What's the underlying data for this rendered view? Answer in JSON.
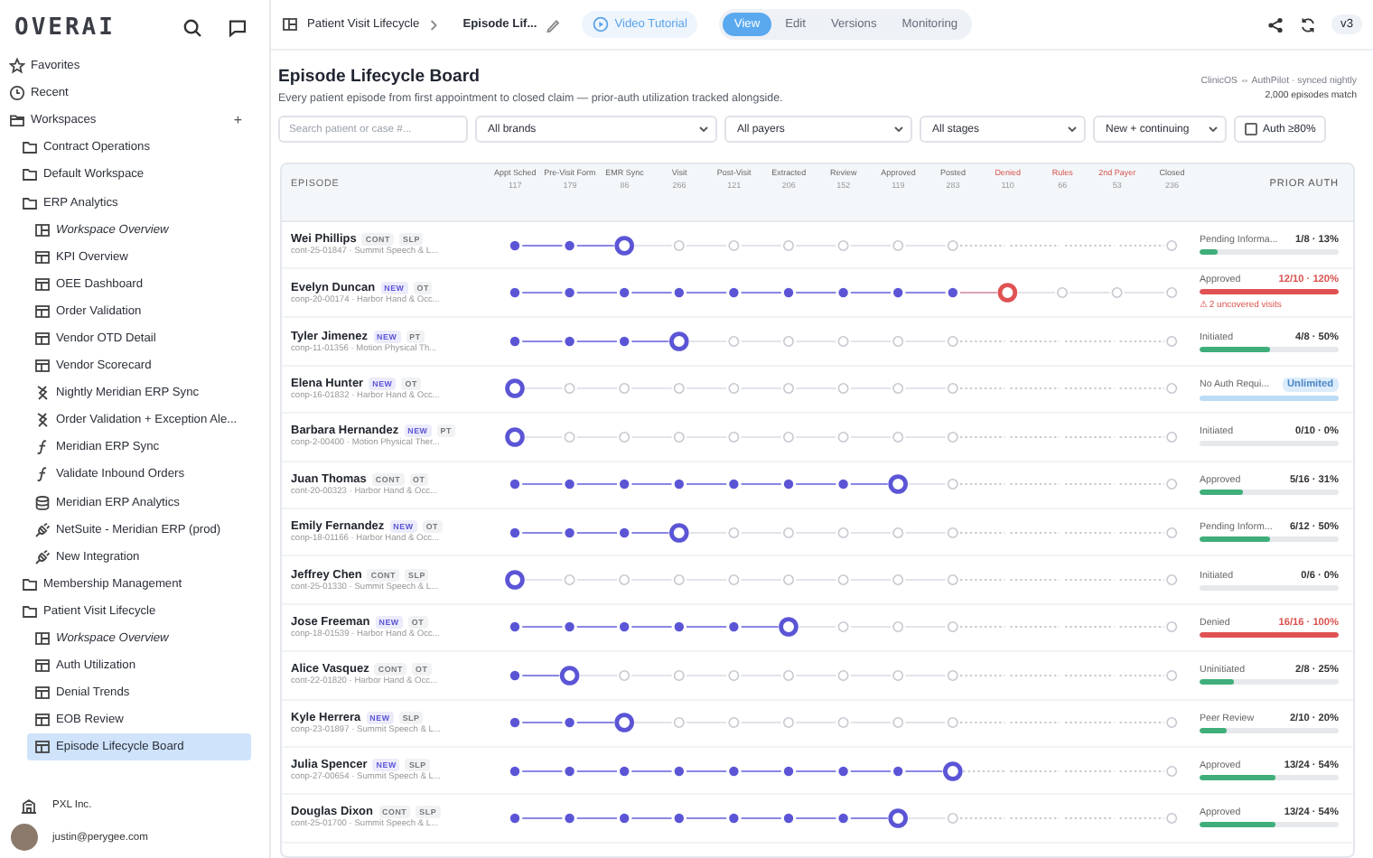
{
  "sidebar": {
    "logo": "OVERAI",
    "sections": [
      {
        "label": "Favorites",
        "kind": "favorites"
      },
      {
        "label": "Recent",
        "kind": "recent"
      },
      {
        "label": "Workspaces",
        "kind": "workspaces",
        "add": "+",
        "children": [
          {
            "label": "Contract Operations",
            "kind": "folder"
          },
          {
            "label": "Default Workspace",
            "kind": "folder"
          },
          {
            "label": "ERP Analytics",
            "kind": "folder",
            "children": [
              {
                "label": "Workspace Overview",
                "kind": "overview",
                "selected": false
              },
              {
                "label": "KPI Overview",
                "kind": "dashboard",
                "selected": false
              },
              {
                "label": "OEE Dashboard",
                "kind": "dashboard",
                "selected": false
              },
              {
                "label": "Order Validation",
                "kind": "dashboard",
                "selected": false
              },
              {
                "label": "Vendor OTD Detail",
                "kind": "dashboard",
                "selected": false
              },
              {
                "label": "Vendor Scorecard",
                "kind": "dashboard",
                "selected": false
              },
              {
                "label": "Nightly Meridian ERP Sync",
                "kind": "flow",
                "selected": false
              },
              {
                "label": "Order Validation + Exception Ale...",
                "kind": "flow",
                "selected": false
              },
              {
                "label": "Meridian ERP Sync",
                "kind": "function",
                "selected": false
              },
              {
                "label": "Validate Inbound Orders",
                "kind": "function",
                "selected": false
              },
              {
                "label": "Meridian ERP Analytics",
                "kind": "database",
                "selected": false
              },
              {
                "label": "NetSuite - Meridian ERP (prod)",
                "kind": "integration",
                "selected": false
              },
              {
                "label": "New Integration",
                "kind": "integration",
                "selected": false
              }
            ]
          },
          {
            "label": "Membership Management",
            "kind": "folder"
          },
          {
            "label": "Patient Visit Lifecycle",
            "kind": "folder",
            "children": [
              {
                "label": "Workspace Overview",
                "kind": "overview",
                "selected": false
              },
              {
                "label": "Auth Utilization",
                "kind": "dashboard",
                "selected": false
              },
              {
                "label": "Denial Trends",
                "kind": "dashboard",
                "selected": false
              },
              {
                "label": "EOB Review",
                "kind": "dashboard",
                "selected": false
              },
              {
                "label": "Episode Lifecycle Board",
                "kind": "dashboard",
                "selected": true
              }
            ]
          }
        ]
      }
    ],
    "org": "PXL Inc.",
    "user": "justin@perygee.com"
  },
  "topbar": {
    "breadcrumb": [
      "Patient Visit Lifecycle",
      "Episode Lif..."
    ],
    "tutorial": "Video Tutorial",
    "tabs": [
      {
        "label": "View",
        "selected": true
      },
      {
        "label": "Edit",
        "selected": false
      },
      {
        "label": "Versions",
        "selected": false
      },
      {
        "label": "Monitoring",
        "selected": false
      }
    ],
    "version": "v3"
  },
  "page": {
    "title": "Episode Lifecycle Board",
    "subtitle": "Every patient episode from first appointment to closed claim — prior-auth utilization tracked alongside.",
    "sync": "ClinicOS ⇔ AuthPilot · synced nightly",
    "match_count": "2,000 episodes match"
  },
  "filters": {
    "search": {
      "placeholder": "Search patient or case #..."
    },
    "selects": [
      "All brands",
      "All payers",
      "All stages",
      "New + continuing"
    ],
    "checkbox": {
      "label": "Auth ≥80%",
      "checked": false
    }
  },
  "table": {
    "episode_header": "EPISODE",
    "auth_header": "PRIOR AUTH",
    "stages": [
      {
        "label": "Appt Sched",
        "count": "117",
        "exception": false
      },
      {
        "label": "Pre-Visit Form",
        "count": "179",
        "exception": false
      },
      {
        "label": "EMR Sync",
        "count": "86",
        "exception": false
      },
      {
        "label": "Visit",
        "count": "266",
        "exception": false
      },
      {
        "label": "Post-Visit",
        "count": "121",
        "exception": false
      },
      {
        "label": "Extracted",
        "count": "206",
        "exception": false
      },
      {
        "label": "Review",
        "count": "152",
        "exception": false
      },
      {
        "label": "Approved",
        "count": "119",
        "exception": false
      },
      {
        "label": "Posted",
        "count": "283",
        "exception": false
      },
      {
        "label": "Denied",
        "count": "110",
        "exception": true
      },
      {
        "label": "Rules",
        "count": "66",
        "exception": true
      },
      {
        "label": "2nd Payer",
        "count": "53",
        "exception": true
      },
      {
        "label": "Closed",
        "count": "236",
        "exception": false
      }
    ],
    "rows": [
      {
        "name": "Wei Phillips",
        "tags": [
          {
            "label": "CONT",
            "kind": "cont"
          },
          {
            "label": "SLP",
            "kind": "discipline"
          }
        ],
        "case": "cont-25-01847 · Summit Speech & L...",
        "stages": [
          {
            "kind": "done"
          },
          {
            "kind": "done"
          },
          {
            "kind": "current"
          },
          {
            "kind": "pending"
          },
          {
            "kind": "pending"
          },
          {
            "kind": "pending"
          },
          {
            "kind": "pending"
          },
          {
            "kind": "pending"
          },
          {
            "kind": "pending"
          },
          {
            "kind": "skipped"
          },
          {
            "kind": "skipped"
          },
          {
            "kind": "skipped"
          },
          {
            "kind": "pending"
          }
        ],
        "auth": {
          "status": "Pending Informa...",
          "usage": "1/8 · 13%",
          "level": 0.13,
          "kind": "ok"
        }
      },
      {
        "name": "Evelyn Duncan",
        "tags": [
          {
            "label": "NEW",
            "kind": "new"
          },
          {
            "label": "OT",
            "kind": "discipline"
          }
        ],
        "case": "conp-20-00174 · Harbor Hand & Occ...",
        "stages": [
          {
            "kind": "done"
          },
          {
            "kind": "done"
          },
          {
            "kind": "done"
          },
          {
            "kind": "done"
          },
          {
            "kind": "done"
          },
          {
            "kind": "done"
          },
          {
            "kind": "done"
          },
          {
            "kind": "done"
          },
          {
            "kind": "done"
          },
          {
            "kind": "denied"
          },
          {
            "kind": "pending"
          },
          {
            "kind": "pending"
          },
          {
            "kind": "pending"
          }
        ],
        "auth": {
          "status": "Approved",
          "usage": "12/10 · 120%",
          "level": 1,
          "kind": "over",
          "warning": "⚠ 2 uncovered visits"
        }
      },
      {
        "name": "Tyler Jimenez",
        "tags": [
          {
            "label": "NEW",
            "kind": "new"
          },
          {
            "label": "PT",
            "kind": "discipline"
          }
        ],
        "case": "conp-11-01356 · Motion Physical Th...",
        "stages": [
          {
            "kind": "done"
          },
          {
            "kind": "done"
          },
          {
            "kind": "done"
          },
          {
            "kind": "current"
          },
          {
            "kind": "pending"
          },
          {
            "kind": "pending"
          },
          {
            "kind": "pending"
          },
          {
            "kind": "pending"
          },
          {
            "kind": "pending"
          },
          {
            "kind": "skipped"
          },
          {
            "kind": "skipped"
          },
          {
            "kind": "skipped"
          },
          {
            "kind": "pending"
          }
        ],
        "auth": {
          "status": "Initiated",
          "usage": "4/8 · 50%",
          "level": 0.5,
          "kind": "ok"
        }
      },
      {
        "name": "Elena Hunter",
        "tags": [
          {
            "label": "NEW",
            "kind": "new"
          },
          {
            "label": "OT",
            "kind": "discipline"
          }
        ],
        "case": "conp-16-01832 · Harbor Hand & Occ...",
        "stages": [
          {
            "kind": "current"
          },
          {
            "kind": "pending"
          },
          {
            "kind": "pending"
          },
          {
            "kind": "pending"
          },
          {
            "kind": "pending"
          },
          {
            "kind": "pending"
          },
          {
            "kind": "pending"
          },
          {
            "kind": "pending"
          },
          {
            "kind": "pending"
          },
          {
            "kind": "skipped"
          },
          {
            "kind": "skipped"
          },
          {
            "kind": "skipped"
          },
          {
            "kind": "pending"
          }
        ],
        "auth": {
          "status": "No Auth Requi...",
          "usage": "Unlimited",
          "level": 1,
          "kind": "unlimited"
        }
      },
      {
        "name": "Barbara Hernandez",
        "tags": [
          {
            "label": "NEW",
            "kind": "new"
          },
          {
            "label": "PT",
            "kind": "discipline"
          }
        ],
        "case": "conp-2-00400 · Motion Physical Ther...",
        "stages": [
          {
            "kind": "current"
          },
          {
            "kind": "pending"
          },
          {
            "kind": "pending"
          },
          {
            "kind": "pending"
          },
          {
            "kind": "pending"
          },
          {
            "kind": "pending"
          },
          {
            "kind": "pending"
          },
          {
            "kind": "pending"
          },
          {
            "kind": "pending"
          },
          {
            "kind": "skipped"
          },
          {
            "kind": "skipped"
          },
          {
            "kind": "skipped"
          },
          {
            "kind": "pending"
          }
        ],
        "auth": {
          "status": "Initiated",
          "usage": "0/10 · 0%",
          "level": 0,
          "kind": "ok"
        }
      },
      {
        "name": "Juan Thomas",
        "tags": [
          {
            "label": "CONT",
            "kind": "cont"
          },
          {
            "label": "OT",
            "kind": "discipline"
          }
        ],
        "case": "cont-20-00323 · Harbor Hand & Occ...",
        "stages": [
          {
            "kind": "done"
          },
          {
            "kind": "done"
          },
          {
            "kind": "done"
          },
          {
            "kind": "done"
          },
          {
            "kind": "done"
          },
          {
            "kind": "done"
          },
          {
            "kind": "done"
          },
          {
            "kind": "current"
          },
          {
            "kind": "pending"
          },
          {
            "kind": "skipped"
          },
          {
            "kind": "skipped"
          },
          {
            "kind": "skipped"
          },
          {
            "kind": "pending"
          }
        ],
        "auth": {
          "status": "Approved",
          "usage": "5/16 · 31%",
          "level": 0.31,
          "kind": "ok"
        }
      },
      {
        "name": "Emily Fernandez",
        "tags": [
          {
            "label": "NEW",
            "kind": "new"
          },
          {
            "label": "OT",
            "kind": "discipline"
          }
        ],
        "case": "conp-18-01166 · Harbor Hand & Occ...",
        "stages": [
          {
            "kind": "done"
          },
          {
            "kind": "done"
          },
          {
            "kind": "done"
          },
          {
            "kind": "current"
          },
          {
            "kind": "pending"
          },
          {
            "kind": "pending"
          },
          {
            "kind": "pending"
          },
          {
            "kind": "pending"
          },
          {
            "kind": "pending"
          },
          {
            "kind": "skipped"
          },
          {
            "kind": "skipped"
          },
          {
            "kind": "skipped"
          },
          {
            "kind": "pending"
          }
        ],
        "auth": {
          "status": "Pending Inform...",
          "usage": "6/12 · 50%",
          "level": 0.5,
          "kind": "ok"
        }
      },
      {
        "name": "Jeffrey Chen",
        "tags": [
          {
            "label": "CONT",
            "kind": "cont"
          },
          {
            "label": "SLP",
            "kind": "discipline"
          }
        ],
        "case": "cont-25-01330 · Summit Speech & L...",
        "stages": [
          {
            "kind": "current"
          },
          {
            "kind": "pending"
          },
          {
            "kind": "pending"
          },
          {
            "kind": "pending"
          },
          {
            "kind": "pending"
          },
          {
            "kind": "pending"
          },
          {
            "kind": "pending"
          },
          {
            "kind": "pending"
          },
          {
            "kind": "pending"
          },
          {
            "kind": "skipped"
          },
          {
            "kind": "skipped"
          },
          {
            "kind": "skipped"
          },
          {
            "kind": "pending"
          }
        ],
        "auth": {
          "status": "Initiated",
          "usage": "0/6 · 0%",
          "level": 0,
          "kind": "ok"
        }
      },
      {
        "name": "Jose Freeman",
        "tags": [
          {
            "label": "NEW",
            "kind": "new"
          },
          {
            "label": "OT",
            "kind": "discipline"
          }
        ],
        "case": "conp-18-01539 · Harbor Hand & Occ...",
        "stages": [
          {
            "kind": "done"
          },
          {
            "kind": "done"
          },
          {
            "kind": "done"
          },
          {
            "kind": "done"
          },
          {
            "kind": "done"
          },
          {
            "kind": "current"
          },
          {
            "kind": "pending"
          },
          {
            "kind": "pending"
          },
          {
            "kind": "pending"
          },
          {
            "kind": "skipped"
          },
          {
            "kind": "skipped"
          },
          {
            "kind": "skipped"
          },
          {
            "kind": "pending"
          }
        ],
        "auth": {
          "status": "Denied",
          "usage": "16/16 · 100%",
          "level": 1,
          "kind": "over"
        }
      },
      {
        "name": "Alice Vasquez",
        "tags": [
          {
            "label": "CONT",
            "kind": "cont"
          },
          {
            "label": "OT",
            "kind": "discipline"
          }
        ],
        "case": "cont-22-01820 · Harbor Hand & Occ...",
        "stages": [
          {
            "kind": "done"
          },
          {
            "kind": "current"
          },
          {
            "kind": "pending"
          },
          {
            "kind": "pending"
          },
          {
            "kind": "pending"
          },
          {
            "kind": "pending"
          },
          {
            "kind": "pending"
          },
          {
            "kind": "pending"
          },
          {
            "kind": "pending"
          },
          {
            "kind": "skipped"
          },
          {
            "kind": "skipped"
          },
          {
            "kind": "skipped"
          },
          {
            "kind": "pending"
          }
        ],
        "auth": {
          "status": "Uninitiated",
          "usage": "2/8 · 25%",
          "level": 0.25,
          "kind": "ok"
        }
      },
      {
        "name": "Kyle Herrera",
        "tags": [
          {
            "label": "NEW",
            "kind": "new"
          },
          {
            "label": "SLP",
            "kind": "discipline"
          }
        ],
        "case": "conp-23-01897 · Summit Speech & L...",
        "stages": [
          {
            "kind": "done"
          },
          {
            "kind": "done"
          },
          {
            "kind": "current"
          },
          {
            "kind": "pending"
          },
          {
            "kind": "pending"
          },
          {
            "kind": "pending"
          },
          {
            "kind": "pending"
          },
          {
            "kind": "pending"
          },
          {
            "kind": "pending"
          },
          {
            "kind": "skipped"
          },
          {
            "kind": "skipped"
          },
          {
            "kind": "skipped"
          },
          {
            "kind": "pending"
          }
        ],
        "auth": {
          "status": "Peer Review",
          "usage": "2/10 · 20%",
          "level": 0.2,
          "kind": "ok"
        }
      },
      {
        "name": "Julia Spencer",
        "tags": [
          {
            "label": "NEW",
            "kind": "new"
          },
          {
            "label": "SLP",
            "kind": "discipline"
          }
        ],
        "case": "conp-27-00654 · Summit Speech & L...",
        "stages": [
          {
            "kind": "done"
          },
          {
            "kind": "done"
          },
          {
            "kind": "done"
          },
          {
            "kind": "done"
          },
          {
            "kind": "done"
          },
          {
            "kind": "done"
          },
          {
            "kind": "done"
          },
          {
            "kind": "done"
          },
          {
            "kind": "current"
          },
          {
            "kind": "skipped"
          },
          {
            "kind": "skipped"
          },
          {
            "kind": "skipped"
          },
          {
            "kind": "pending"
          }
        ],
        "auth": {
          "status": "Approved",
          "usage": "13/24 · 54%",
          "level": 0.54,
          "kind": "ok"
        }
      },
      {
        "name": "Douglas Dixon",
        "tags": [
          {
            "label": "CONT",
            "kind": "cont"
          },
          {
            "label": "SLP",
            "kind": "discipline"
          }
        ],
        "case": "cont-25-01700 · Summit Speech & L...",
        "stages": [
          {
            "kind": "done"
          },
          {
            "kind": "done"
          },
          {
            "kind": "done"
          },
          {
            "kind": "done"
          },
          {
            "kind": "done"
          },
          {
            "kind": "done"
          },
          {
            "kind": "done"
          },
          {
            "kind": "current"
          },
          {
            "kind": "pending"
          },
          {
            "kind": "skipped"
          },
          {
            "kind": "skipped"
          },
          {
            "kind": "skipped"
          },
          {
            "kind": "pending"
          }
        ],
        "auth": {
          "status": "Approved",
          "usage": "13/24 · 54%",
          "level": 0.54,
          "kind": "ok"
        }
      }
    ]
  }
}
